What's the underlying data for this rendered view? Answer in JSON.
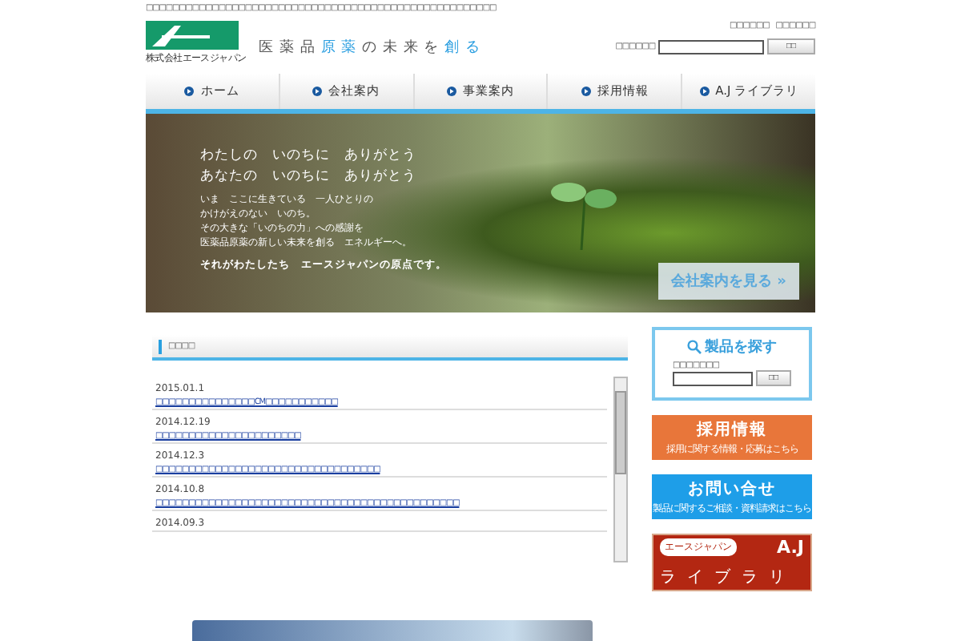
{
  "top_note": "□□□□□□□□□□□□□□□□□□□□□□□□□□□□□□□□□□□□□□□□□□□□□□□□□□□□□",
  "header": {
    "company": "株式会社エースジャパン",
    "tagline_parts": [
      {
        "text": "医 薬 品 ",
        "accent": false
      },
      {
        "text": "原 薬",
        "accent": true
      },
      {
        "text": " の 未 来 を ",
        "accent": false
      },
      {
        "text": "創 る",
        "accent": true
      }
    ],
    "links": [
      "□□□□□□",
      "□□□□□□"
    ],
    "search": {
      "label": "□□□□□□",
      "button": "□□"
    }
  },
  "nav": [
    {
      "label": "ホーム",
      "selected": false
    },
    {
      "label": "会社案内",
      "selected": false
    },
    {
      "label": "事業案内",
      "selected": false
    },
    {
      "label": "採用情報",
      "selected": false
    },
    {
      "label": "A.J ライブラリ",
      "selected": false
    }
  ],
  "hero": {
    "headline": [
      "わたしの　いのちに　ありがとう",
      "あなたの　いのちに　ありがとう"
    ],
    "body": [
      "いま　ここに生きている　一人ひとりの",
      "かけがえのない　いのち。",
      "その大きな「いのちの力」への感謝を",
      "医薬品原薬の新しい未来を創る　エネルギーへ。"
    ],
    "closing": "それがわたしたち　エースジャパンの原点です。",
    "button": "会社案内を見る »"
  },
  "news": {
    "title": "□□□□",
    "items": [
      {
        "date": "2015.01.1",
        "title": "□□□□□□□□□□□□□□□CM□□□□□□□□□□□"
      },
      {
        "date": "2014.12.19",
        "title": "□□□□□□□□□□□□□□□□□□□□□□"
      },
      {
        "date": "2014.12.3",
        "title": "□□□□□□□□□□□□□□□□□□□□□□□□□□□□□□□□□□"
      },
      {
        "date": "2014.10.8",
        "title": "□□□□□□□□□□□□□□□□□□□□□□□□□□□□□□□□□□□□□□□□□□□□□□"
      },
      {
        "date": "2014.09.3"
      }
    ]
  },
  "product_search": {
    "title": "製品を探す",
    "label": "□□□□□□□",
    "button": "□□"
  },
  "banners": [
    {
      "kind": "recruit",
      "title": "採用情報",
      "sub": "採用に関する情報・応募はこちら"
    },
    {
      "kind": "contact",
      "title": "お問い合せ",
      "sub": "製品に関するご相談・資料請求はこちら"
    },
    {
      "kind": "library",
      "title": "A.J",
      "sub": "ライブラリ",
      "tag": "エースジャパン"
    }
  ]
}
